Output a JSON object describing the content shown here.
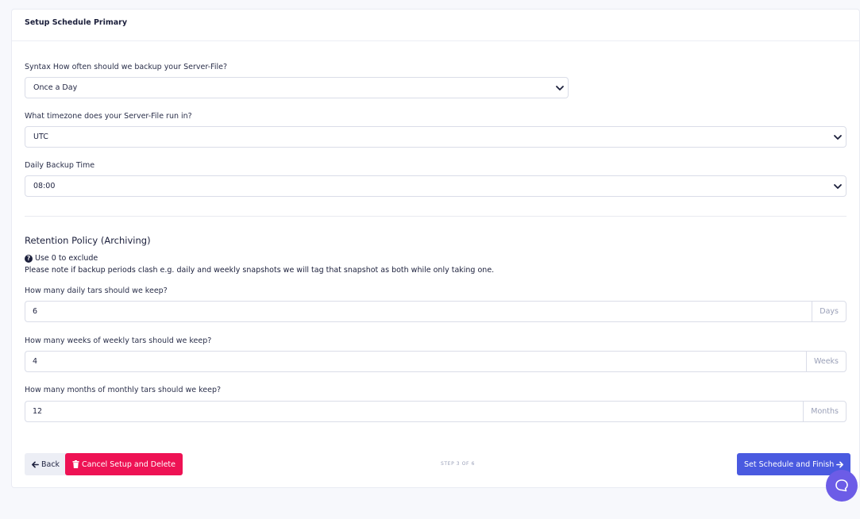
{
  "card": {
    "title": "Setup Schedule Primary"
  },
  "schedule": {
    "frequency_label": "Syntax How often should we backup your Server-File?",
    "frequency_value": "Once a Day",
    "timezone_label": "What timezone does your Server-File run in?",
    "timezone_value": "UTC",
    "time_label": "Daily Backup Time",
    "time_value": "08:00"
  },
  "retention": {
    "title": "Retention Policy (Archiving)",
    "hint": "Use 0 to exclude",
    "note": "Please note if backup periods clash e.g. daily and weekly snapshots we will tag that snapshot as both while only taking one.",
    "daily_label": "How many daily tars should we keep?",
    "daily_value": "6",
    "daily_unit": "Days",
    "weekly_label": "How many weeks of weekly tars should we keep?",
    "weekly_value": "4",
    "weekly_unit": "Weeks",
    "monthly_label": "How many months of monthly tars should we keep?",
    "monthly_value": "12",
    "monthly_unit": "Months"
  },
  "footer": {
    "back_label": "Back",
    "cancel_label": "Cancel Setup and Delete",
    "step_text": "STEP 3 OF 6",
    "finish_label": "Set Schedule and Finish"
  },
  "icons": {
    "back": "arrow-left-icon",
    "cancel": "trash-icon",
    "finish": "arrow-right-icon",
    "hint": "question-circle-icon",
    "chat": "chat-bubble-icon",
    "select": "chevron-down-icon"
  },
  "colors": {
    "primary": "#4a5ae0",
    "danger": "#ee1254",
    "chat": "#6c5ce7"
  }
}
